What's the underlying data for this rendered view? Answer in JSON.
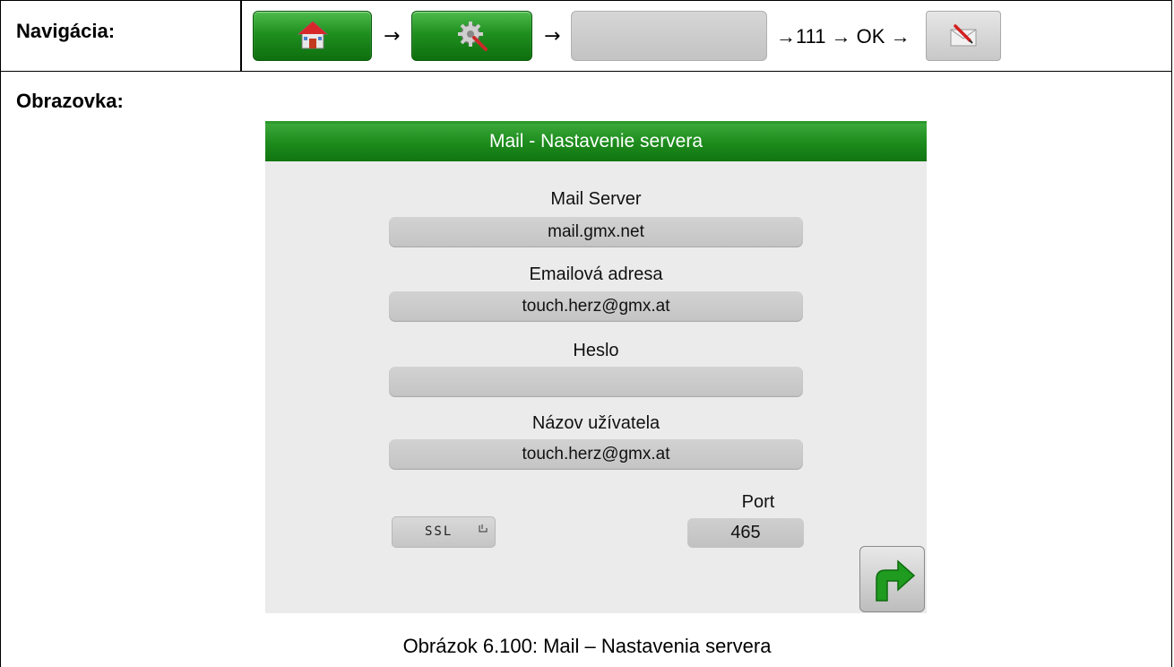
{
  "navigation": {
    "label": "Navigácia:",
    "arrow": "→",
    "sequence_text": "→111 → OK →",
    "buttons": [
      {
        "name": "home-button",
        "icon": "house-icon"
      },
      {
        "name": "settings-button",
        "icon": "gear-wrench-icon"
      },
      {
        "name": "blank-button",
        "icon": ""
      },
      {
        "name": "mail-settings-button",
        "icon": "mail-pencil-icon"
      }
    ]
  },
  "screen_section": {
    "label": "Obrazovka:"
  },
  "screen": {
    "title": "Mail - Nastavenie servera",
    "fields": {
      "mail_server": {
        "label": "Mail Server",
        "value": "mail.gmx.net"
      },
      "email": {
        "label": "Emailová adresa",
        "value": "touch.herz@gmx.at"
      },
      "password": {
        "label": "Heslo",
        "value": ""
      },
      "username": {
        "label": "Názov užívatela",
        "value": "touch.herz@gmx.at"
      }
    },
    "ssl": {
      "label": "SSL",
      "check_icon": "checkbox-icon"
    },
    "port": {
      "label": "Port",
      "value": "465"
    },
    "next_icon": "turn-right-arrow-icon"
  },
  "colors": {
    "header_green": "#1d8c1d",
    "screen_bg": "#ebebeb",
    "field_gray": "#c8c8c8"
  },
  "caption": "Obrázok 6.100: Mail – Nastavenia servera"
}
